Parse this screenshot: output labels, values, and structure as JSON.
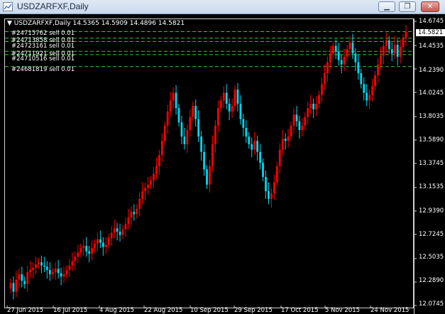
{
  "window": {
    "title": "USDZARFXF,Daily",
    "buttons": [
      {
        "name": "minimize-button",
        "glyph": "▁"
      },
      {
        "name": "restore-button",
        "glyph": "❐"
      },
      {
        "name": "close-button",
        "glyph": "✕"
      }
    ]
  },
  "chart_header": {
    "symbol_line": "USDZARFXF,Daily  14.5365 14.5909 14.4896 14.5821"
  },
  "orders": [
    {
      "label": "#24715762 sell 0.01",
      "price": 14.58
    },
    {
      "label": "#24713858 sell 0.01",
      "price": 14.52
    },
    {
      "label": "#24723161 sell 0.01",
      "price": 14.49
    },
    {
      "label": "#24711921 sell 0.01",
      "price": 14.4
    },
    {
      "label": "#24710516 sell 0.01",
      "price": 14.37
    },
    {
      "label": "#24681819 sell 0.01",
      "price": 14.26
    }
  ],
  "colors": {
    "background": "#000000",
    "bull": "#ff0000",
    "bear": "#00d8f0",
    "order_line": "#3cbf3c",
    "axis": "#d0d0d0"
  },
  "chart_data": {
    "type": "candlestick",
    "y_ticks": [
      "14.6745",
      "14.4535",
      "14.2390",
      "14.0245",
      "13.8035",
      "13.5890",
      "13.3745",
      "13.1535",
      "12.9390",
      "12.7245",
      "12.5035",
      "12.2890",
      "12.0745"
    ],
    "y_range": [
      12.0745,
      14.6745
    ],
    "current_price": "14.5821",
    "x_ticks": [
      "27 Jun 2015",
      "16 Jul 2015",
      "4 Aug 2015",
      "22 Aug 2015",
      "10 Sep 2015",
      "29 Sep 2015",
      "17 Oct 2015",
      "5 Nov 2015",
      "24 Nov 2015"
    ],
    "closes": [
      12.28,
      12.2,
      12.31,
      12.36,
      12.3,
      12.27,
      12.38,
      12.4,
      12.42,
      12.45,
      12.47,
      12.44,
      12.43,
      12.4,
      12.36,
      12.38,
      12.41,
      12.37,
      12.34,
      12.36,
      12.4,
      12.44,
      12.48,
      12.52,
      12.56,
      12.6,
      12.62,
      12.57,
      12.55,
      12.6,
      12.64,
      12.68,
      12.65,
      12.61,
      12.63,
      12.69,
      12.74,
      12.78,
      12.75,
      12.72,
      12.77,
      12.82,
      12.88,
      12.93,
      12.91,
      12.96,
      13.05,
      13.12,
      13.15,
      13.18,
      13.22,
      13.28,
      13.35,
      13.45,
      13.58,
      13.72,
      13.85,
      13.95,
      14.02,
      13.88,
      13.75,
      13.62,
      13.55,
      13.68,
      13.8,
      13.9,
      13.78,
      13.62,
      13.48,
      13.32,
      13.18,
      13.35,
      13.55,
      13.72,
      13.88,
      13.95,
      14.02,
      13.92,
      13.85,
      13.9,
      14.05,
      13.92,
      13.78,
      13.7,
      13.62,
      13.55,
      13.5,
      13.58,
      13.48,
      13.38,
      13.25,
      13.12,
      13.05,
      13.1,
      13.2,
      13.35,
      13.5,
      13.6,
      13.58,
      13.62,
      13.72,
      13.82,
      13.76,
      13.68,
      13.72,
      13.8,
      13.88,
      13.92,
      13.87,
      13.92,
      14.0,
      14.1,
      14.2,
      14.3,
      14.38,
      14.45,
      14.4,
      14.32,
      14.28,
      14.35,
      14.42,
      14.48,
      14.38,
      14.3,
      14.2,
      14.1,
      14.02,
      13.95,
      14.0,
      14.08,
      14.18,
      14.28,
      14.36,
      14.45,
      14.5,
      14.42,
      14.38,
      14.46,
      14.35,
      14.44,
      14.52,
      14.58
    ]
  }
}
